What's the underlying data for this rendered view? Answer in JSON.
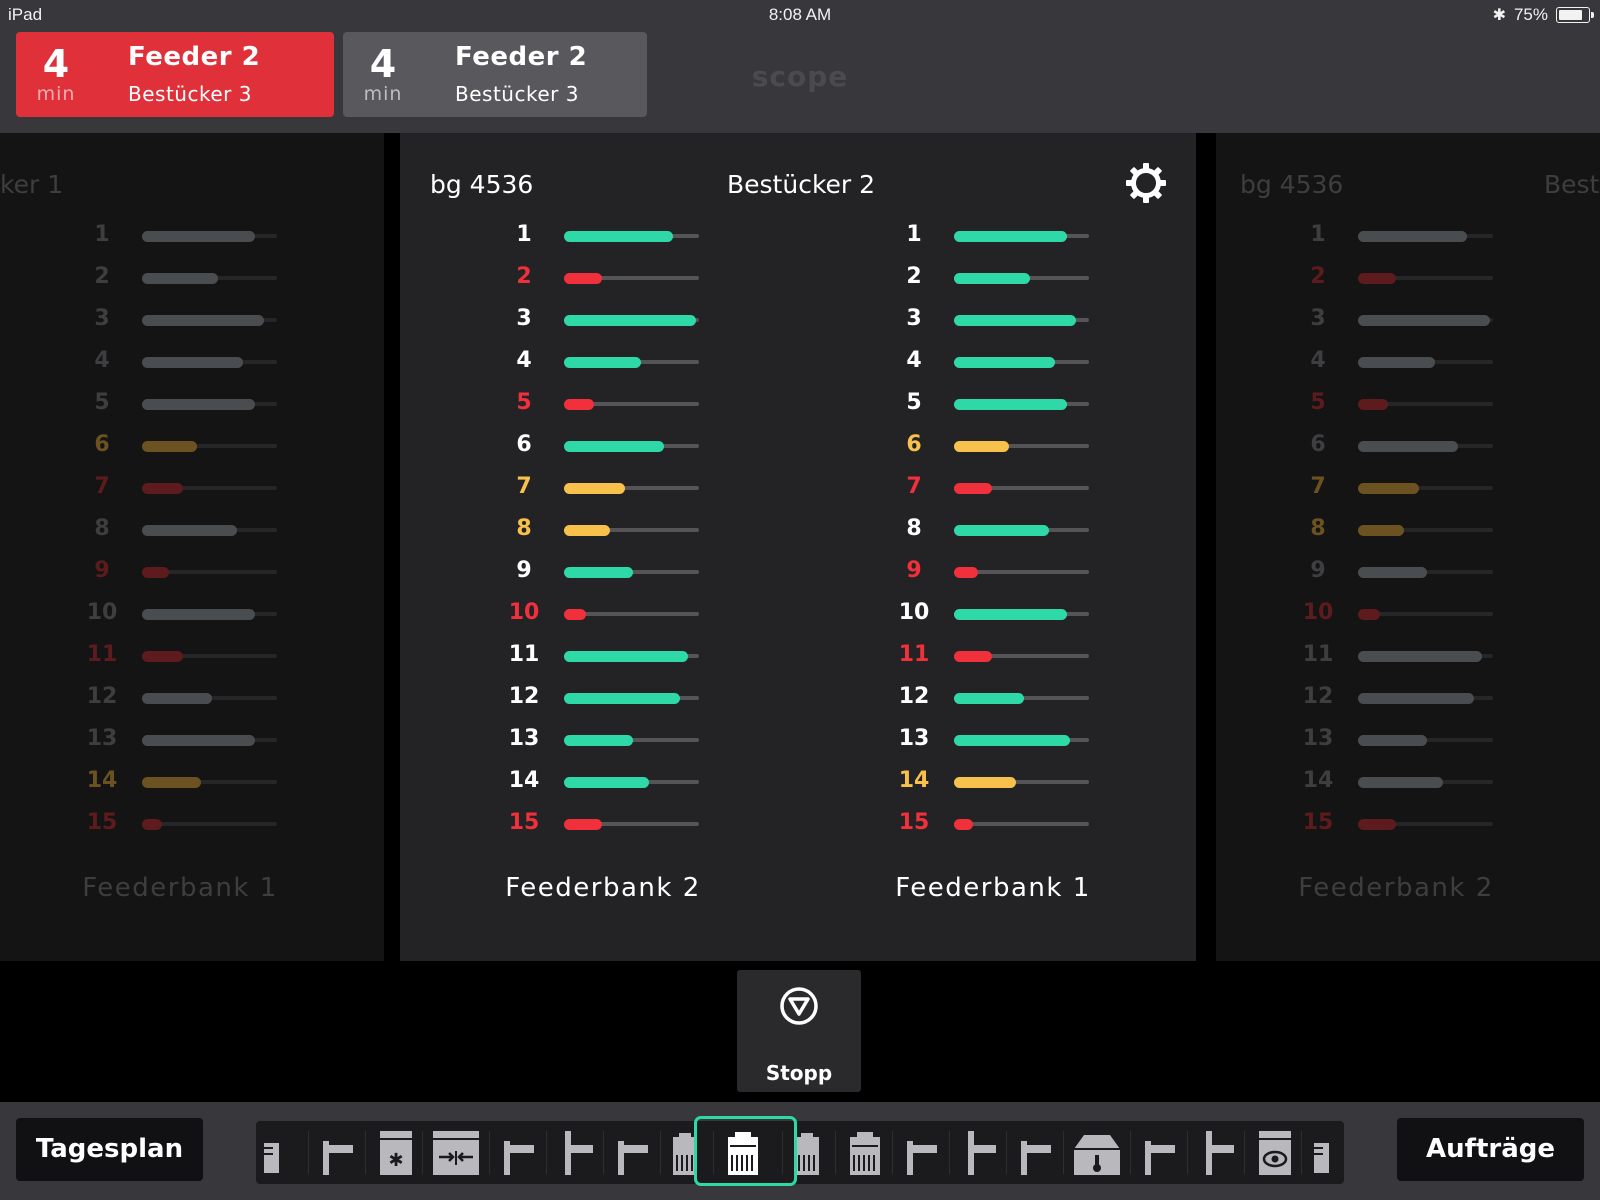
{
  "status_bar": {
    "device": "iPad",
    "time": "8:08 AM",
    "battery_text": "75%",
    "battery_level": 0.75
  },
  "header": {
    "logo": "scope",
    "alerts": [
      {
        "value": "4",
        "unit": "min",
        "title": "Feeder 2",
        "subtitle": "Bestücker 3",
        "state": "critical"
      },
      {
        "value": "4",
        "unit": "min",
        "title": "Feeder 2",
        "subtitle": "Bestücker 3",
        "state": "normal"
      }
    ]
  },
  "colors": {
    "ok": "#2fd9a7",
    "warn": "#f7c14b",
    "critical": "#f0303a",
    "alert_bg": "#e0313a",
    "alert_bg_secondary": "#58585d",
    "active_outline": "#2fd9a7"
  },
  "left_panel": {
    "title": "ker 1",
    "banks": [
      {
        "label": "Feederbank 1",
        "rows": [
          {
            "n": "1",
            "level": 0.84,
            "status": "ok"
          },
          {
            "n": "2",
            "level": 0.56,
            "status": "ok"
          },
          {
            "n": "3",
            "level": 0.9,
            "status": "ok"
          },
          {
            "n": "4",
            "level": 0.75,
            "status": "ok"
          },
          {
            "n": "5",
            "level": 0.84,
            "status": "ok"
          },
          {
            "n": "6",
            "level": 0.41,
            "status": "warn"
          },
          {
            "n": "7",
            "level": 0.3,
            "status": "critical"
          },
          {
            "n": "8",
            "level": 0.7,
            "status": "ok"
          },
          {
            "n": "9",
            "level": 0.2,
            "status": "critical"
          },
          {
            "n": "10",
            "level": 0.84,
            "status": "ok"
          },
          {
            "n": "11",
            "level": 0.3,
            "status": "critical"
          },
          {
            "n": "12",
            "level": 0.52,
            "status": "ok"
          },
          {
            "n": "13",
            "level": 0.84,
            "status": "ok"
          },
          {
            "n": "14",
            "level": 0.44,
            "status": "warn"
          },
          {
            "n": "15",
            "level": 0.15,
            "status": "critical"
          }
        ]
      }
    ]
  },
  "main_panel": {
    "order": "bg 4536",
    "machine": "Bestücker 2",
    "banks": [
      {
        "label": "Feederbank 2",
        "rows": [
          {
            "n": "1",
            "level": 0.81,
            "status": "ok"
          },
          {
            "n": "2",
            "level": 0.28,
            "status": "critical"
          },
          {
            "n": "3",
            "level": 0.98,
            "status": "ok"
          },
          {
            "n": "4",
            "level": 0.57,
            "status": "ok"
          },
          {
            "n": "5",
            "level": 0.22,
            "status": "critical"
          },
          {
            "n": "6",
            "level": 0.74,
            "status": "ok"
          },
          {
            "n": "7",
            "level": 0.45,
            "status": "warn"
          },
          {
            "n": "8",
            "level": 0.34,
            "status": "warn"
          },
          {
            "n": "9",
            "level": 0.51,
            "status": "ok"
          },
          {
            "n": "10",
            "level": 0.16,
            "status": "critical"
          },
          {
            "n": "11",
            "level": 0.92,
            "status": "ok"
          },
          {
            "n": "12",
            "level": 0.86,
            "status": "ok"
          },
          {
            "n": "13",
            "level": 0.51,
            "status": "ok"
          },
          {
            "n": "14",
            "level": 0.63,
            "status": "ok"
          },
          {
            "n": "15",
            "level": 0.28,
            "status": "critical"
          }
        ]
      },
      {
        "label": "Feederbank 1",
        "rows": [
          {
            "n": "1",
            "level": 0.84,
            "status": "ok"
          },
          {
            "n": "2",
            "level": 0.56,
            "status": "ok"
          },
          {
            "n": "3",
            "level": 0.9,
            "status": "ok"
          },
          {
            "n": "4",
            "level": 0.75,
            "status": "ok"
          },
          {
            "n": "5",
            "level": 0.84,
            "status": "ok"
          },
          {
            "n": "6",
            "level": 0.41,
            "status": "warn"
          },
          {
            "n": "7",
            "level": 0.28,
            "status": "critical"
          },
          {
            "n": "8",
            "level": 0.7,
            "status": "ok"
          },
          {
            "n": "9",
            "level": 0.18,
            "status": "critical"
          },
          {
            "n": "10",
            "level": 0.84,
            "status": "ok"
          },
          {
            "n": "11",
            "level": 0.28,
            "status": "critical"
          },
          {
            "n": "12",
            "level": 0.52,
            "status": "ok"
          },
          {
            "n": "13",
            "level": 0.86,
            "status": "ok"
          },
          {
            "n": "14",
            "level": 0.46,
            "status": "warn"
          },
          {
            "n": "15",
            "level": 0.14,
            "status": "critical"
          }
        ]
      }
    ]
  },
  "right_panel": {
    "order": "bg 4536",
    "title": "Best",
    "banks": [
      {
        "label": "Feederbank 2",
        "rows": [
          {
            "n": "1",
            "level": 0.81,
            "status": "ok"
          },
          {
            "n": "2",
            "level": 0.28,
            "status": "critical"
          },
          {
            "n": "3",
            "level": 0.98,
            "status": "ok"
          },
          {
            "n": "4",
            "level": 0.57,
            "status": "ok"
          },
          {
            "n": "5",
            "level": 0.22,
            "status": "critical"
          },
          {
            "n": "6",
            "level": 0.74,
            "status": "ok"
          },
          {
            "n": "7",
            "level": 0.45,
            "status": "warn"
          },
          {
            "n": "8",
            "level": 0.34,
            "status": "warn"
          },
          {
            "n": "9",
            "level": 0.51,
            "status": "ok"
          },
          {
            "n": "10",
            "level": 0.16,
            "status": "critical"
          },
          {
            "n": "11",
            "level": 0.92,
            "status": "ok"
          },
          {
            "n": "12",
            "level": 0.86,
            "status": "ok"
          },
          {
            "n": "13",
            "level": 0.51,
            "status": "ok"
          },
          {
            "n": "14",
            "level": 0.63,
            "status": "ok"
          },
          {
            "n": "15",
            "level": 0.28,
            "status": "critical"
          }
        ]
      }
    ]
  },
  "stop_button": {
    "label": "Stopp",
    "icon": "stop-triangle-icon"
  },
  "bottom_bar": {
    "left_button": "Tagesplan",
    "right_button": "Aufträge",
    "machines": [
      {
        "icon": "feeder-stub-icon"
      },
      {
        "icon": "pipe-elbow-icon"
      },
      {
        "icon": "oven-star-icon"
      },
      {
        "icon": "press-arrows-icon"
      },
      {
        "icon": "pipe-elbow-icon"
      },
      {
        "icon": "pipe-tee-icon"
      },
      {
        "icon": "pipe-elbow-icon"
      },
      {
        "icon": "placer-half-icon"
      },
      {
        "icon": "placer-machine-icon",
        "active": true
      },
      {
        "icon": "placer-half-icon"
      },
      {
        "icon": "placer-machine-icon"
      },
      {
        "icon": "pipe-elbow-icon"
      },
      {
        "icon": "pipe-tee-icon"
      },
      {
        "icon": "pipe-elbow-icon"
      },
      {
        "icon": "temperature-chamber-icon"
      },
      {
        "icon": "pipe-elbow-icon"
      },
      {
        "icon": "pipe-tee-icon"
      },
      {
        "icon": "inspection-eye-icon"
      },
      {
        "icon": "feeder-stub-icon"
      }
    ]
  }
}
